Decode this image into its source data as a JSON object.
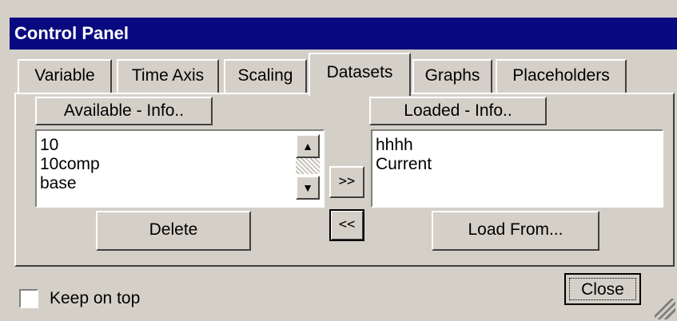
{
  "window": {
    "title": "Control Panel"
  },
  "tabs": [
    {
      "label": "Variable"
    },
    {
      "label": "Time Axis"
    },
    {
      "label": "Scaling"
    },
    {
      "label": "Datasets"
    },
    {
      "label": "Graphs"
    },
    {
      "label": "Placeholders"
    }
  ],
  "active_tab": "Datasets",
  "available": {
    "header_label": "Available - Info..",
    "items": [
      "10",
      "10comp",
      "base"
    ],
    "delete_label": "Delete"
  },
  "loaded": {
    "header_label": "Loaded - Info..",
    "items": [
      "hhhh",
      "Current"
    ],
    "load_from_label": "Load From..."
  },
  "transfer": {
    "add_label": ">>",
    "remove_label": "<<"
  },
  "footer": {
    "keep_on_top_label": "Keep on top",
    "keep_on_top_checked": false,
    "close_label": "Close"
  },
  "colors": {
    "titlebar": "#0a0a80",
    "face": "#d4d0c8"
  }
}
